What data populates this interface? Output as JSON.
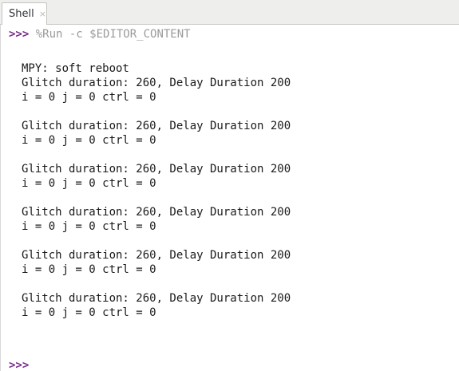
{
  "tab": {
    "label": "Shell",
    "close": "×"
  },
  "shell": {
    "prompt": ">>>",
    "command": " %Run -c $EDITOR_CONTENT",
    "output": [
      "MPY: soft reboot",
      "Glitch duration: 260, Delay Duration 200",
      "i = 0 j = 0 ctrl = 0",
      "Glitch duration: 260, Delay Duration 200",
      "i = 0 j = 0 ctrl = 0",
      "Glitch duration: 260, Delay Duration 200",
      "i = 0 j = 0 ctrl = 0",
      "Glitch duration: 260, Delay Duration 200",
      "i = 0 j = 0 ctrl = 0",
      "Glitch duration: 260, Delay Duration 200",
      "i = 0 j = 0 ctrl = 0",
      "Glitch duration: 260, Delay Duration 200",
      "i = 0 j = 0 ctrl = 0"
    ],
    "final_prompt": ">>>"
  },
  "colors": {
    "prompt": "#7a2e8c",
    "command": "#9a9a9a",
    "text": "#1a1a1a"
  }
}
